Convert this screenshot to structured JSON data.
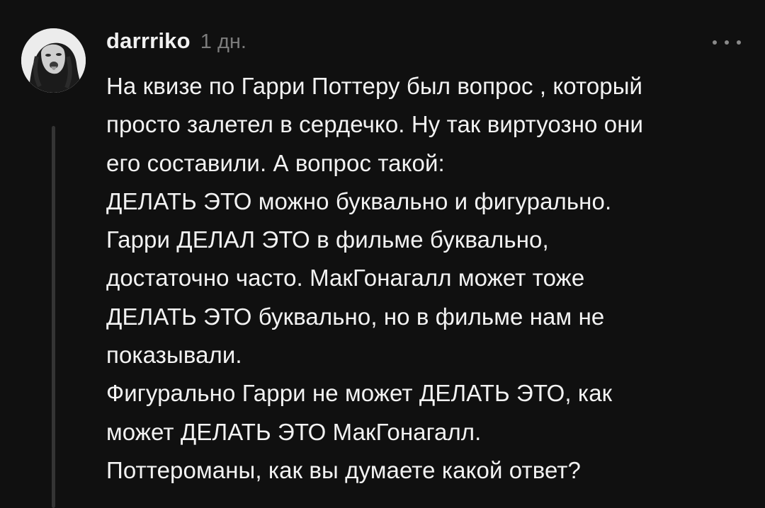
{
  "comment": {
    "username": "darrriko",
    "timestamp": "1 дн.",
    "more_icon": "ellipsis-icon",
    "avatar_icon": "user-photo-avatar",
    "lines": [
      "На квизе по Гарри Поттеру был вопрос , который",
      "просто залетел в сердечко. Ну так виртуозно они",
      "его составили. А вопрос такой:",
      "ДЕЛАТЬ ЭТО можно буквально и фигурально.",
      "Гарри ДЕЛАЛ ЭТО в фильме буквально,",
      "достаточно часто. МакГонагалл может тоже",
      "ДЕЛАТЬ ЭТО буквально, но в фильме нам не",
      "показывали.",
      "Фигурально Гарри не может ДЕЛАТЬ ЭТО, как",
      "может ДЕЛАТЬ ЭТО МакГонагалл.",
      "Поттероманы, как вы думаете какой ответ?"
    ]
  },
  "colors": {
    "background": "#101010",
    "text": "#f2f2f2",
    "muted": "#7c7c7c",
    "thread_line": "#343434"
  }
}
